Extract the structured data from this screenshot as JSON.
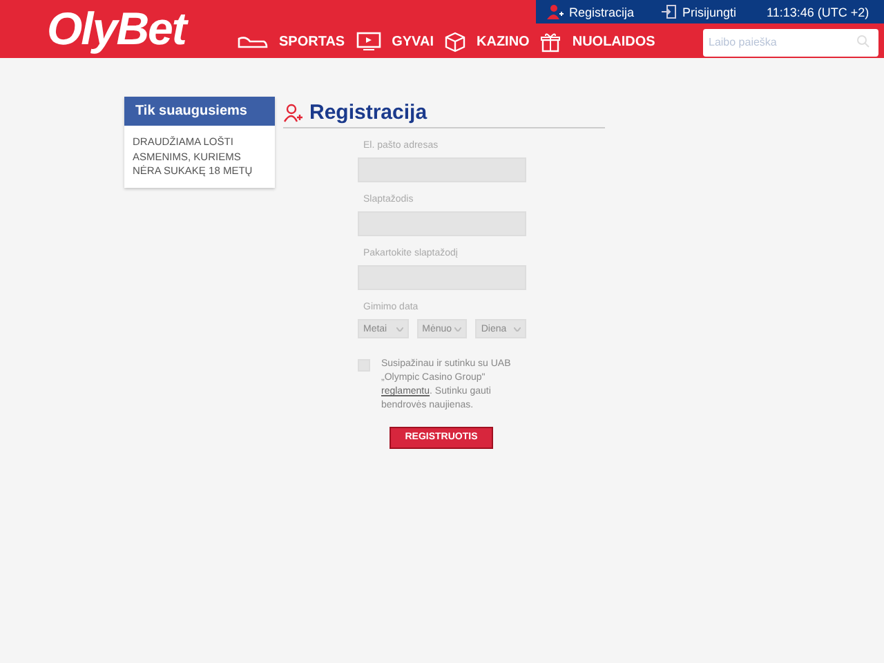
{
  "logo": "OlyBet",
  "top_bar": {
    "register": "Registracija",
    "login": "Prisijungti",
    "clock": "11:13:46 (UTC +2)"
  },
  "nav": [
    {
      "label": "SPORTAS"
    },
    {
      "label": "GYVAI"
    },
    {
      "label": "KAZINO"
    },
    {
      "label": "NUOLAIDOS"
    }
  ],
  "search": {
    "placeholder": "Laibo paieška"
  },
  "sidebar": {
    "title": "Tik suaugusiems",
    "text": "DRAUDŽIAMA LOŠTI ASMENIMS, KURIEMS NĖRA SUKAKĘ 18 METŲ"
  },
  "form": {
    "title": "Registracija",
    "fields": [
      {
        "label": "El. pašto adresas"
      },
      {
        "label": "Slaptažodis"
      },
      {
        "label": "Pakartokite slaptažodį"
      }
    ],
    "birth_label": "Gimimo data",
    "birth_selects": [
      {
        "placeholder": "Metai"
      },
      {
        "placeholder": "Mėnuo"
      },
      {
        "placeholder": "Diena"
      }
    ],
    "consent": {
      "checked": false,
      "text_before": "Susipažinau ir sutinku su UAB „Olympic Casino Group\"",
      "link": "reglamentu",
      "text_after": ". Sutinku gauti bendrovės naujienas."
    },
    "submit": "REGISTRUOTIS"
  }
}
